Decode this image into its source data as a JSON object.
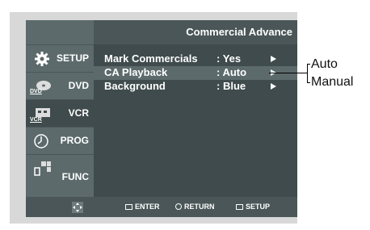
{
  "header": {
    "title": "Commercial Advance"
  },
  "sidebar": {
    "items": [
      {
        "label": "SETUP",
        "icon": "gear-icon"
      },
      {
        "label": "DVD",
        "icon": "dvd-disc-icon",
        "tag": "DVD"
      },
      {
        "label": "VCR",
        "icon": "vcr-icon",
        "tag": "VCR"
      },
      {
        "label": "PROG",
        "icon": "clock-icon"
      },
      {
        "label": "FUNC",
        "icon": "function-icon"
      }
    ]
  },
  "menu": {
    "rows": [
      {
        "label": "Mark Commercials",
        "value": ": Yes"
      },
      {
        "label": "CA Playback",
        "value": ": Auto"
      },
      {
        "label": "Background",
        "value": ": Blue"
      }
    ]
  },
  "footer": {
    "enter": "ENTER",
    "return": "RETURN",
    "setup": "SETUP"
  },
  "callout": {
    "options": [
      "Auto",
      "Manual"
    ]
  }
}
